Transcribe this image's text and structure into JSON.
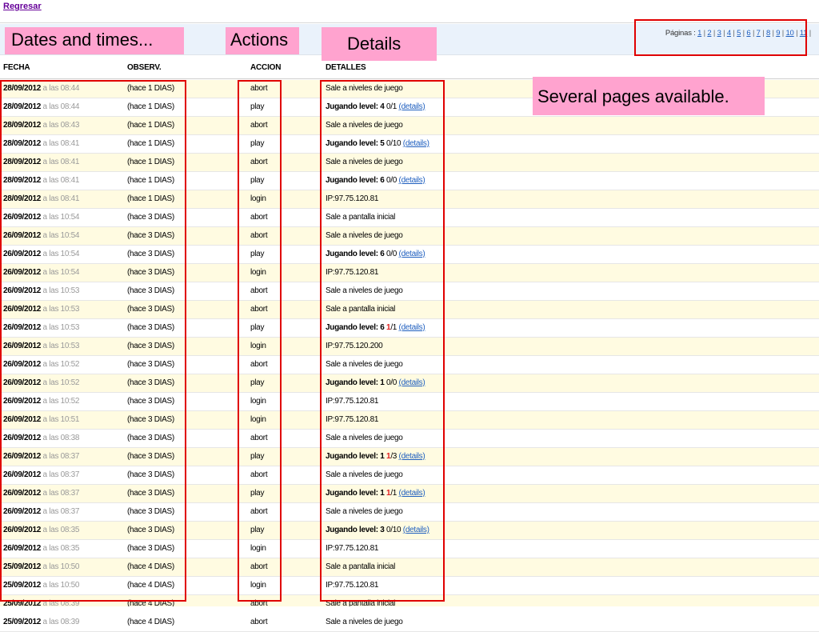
{
  "back_link": "Regresar",
  "pager": {
    "label": "Páginas :",
    "pages": [
      "1",
      "2",
      "3",
      "4",
      "5",
      "6",
      "7",
      "8",
      "9",
      "10",
      "11"
    ]
  },
  "columns": {
    "date": "FECHA",
    "observ": "OBSERV.",
    "action": "ACCION",
    "details": "DETALLES"
  },
  "at_text": "a las",
  "details_link": "(details)",
  "callouts": {
    "dates": "Dates and times...",
    "actions": "Actions",
    "details": "Details",
    "pages": "Several pages available."
  },
  "colors": {
    "highlight": "#e00000",
    "callout_bg": "#ffa3cf",
    "row_alt_bg": "#fffbe1",
    "link": "#1f5fbf"
  },
  "rows": [
    {
      "date": "28/09/2012",
      "time": "08:44",
      "obs": "(hace 1 DIAS)",
      "action": "abort",
      "detail": "Sale a niveles de juego"
    },
    {
      "date": "28/09/2012",
      "time": "08:44",
      "obs": "(hace 1 DIAS)",
      "action": "play",
      "level": "Jugando level: 4",
      "ratio": "0/1",
      "link": true
    },
    {
      "date": "28/09/2012",
      "time": "08:43",
      "obs": "(hace 1 DIAS)",
      "action": "abort",
      "detail": "Sale a niveles de juego"
    },
    {
      "date": "28/09/2012",
      "time": "08:41",
      "obs": "(hace 1 DIAS)",
      "action": "play",
      "level": "Jugando level: 5",
      "ratio": "0/10",
      "link": true
    },
    {
      "date": "28/09/2012",
      "time": "08:41",
      "obs": "(hace 1 DIAS)",
      "action": "abort",
      "detail": "Sale a niveles de juego"
    },
    {
      "date": "28/09/2012",
      "time": "08:41",
      "obs": "(hace 1 DIAS)",
      "action": "play",
      "level": "Jugando level: 6",
      "ratio": "0/0",
      "link": true
    },
    {
      "date": "28/09/2012",
      "time": "08:41",
      "obs": "(hace 1 DIAS)",
      "action": "login",
      "detail": "IP:97.75.120.81"
    },
    {
      "date": "26/09/2012",
      "time": "10:54",
      "obs": "(hace 3 DIAS)",
      "action": "abort",
      "detail": "Sale a pantalla inicial"
    },
    {
      "date": "26/09/2012",
      "time": "10:54",
      "obs": "(hace 3 DIAS)",
      "action": "abort",
      "detail": "Sale a niveles de juego"
    },
    {
      "date": "26/09/2012",
      "time": "10:54",
      "obs": "(hace 3 DIAS)",
      "action": "play",
      "level": "Jugando level: 6",
      "ratio": "0/0",
      "link": true
    },
    {
      "date": "26/09/2012",
      "time": "10:54",
      "obs": "(hace 3 DIAS)",
      "action": "login",
      "detail": "IP:97.75.120.81"
    },
    {
      "date": "26/09/2012",
      "time": "10:53",
      "obs": "(hace 3 DIAS)",
      "action": "abort",
      "detail": "Sale a niveles de juego"
    },
    {
      "date": "26/09/2012",
      "time": "10:53",
      "obs": "(hace 3 DIAS)",
      "action": "abort",
      "detail": "Sale a pantalla inicial"
    },
    {
      "date": "26/09/2012",
      "time": "10:53",
      "obs": "(hace 3 DIAS)",
      "action": "play",
      "level": "Jugando level: 6",
      "ratio": "1/1",
      "red": true,
      "link": true
    },
    {
      "date": "26/09/2012",
      "time": "10:53",
      "obs": "(hace 3 DIAS)",
      "action": "login",
      "detail": "IP:97.75.120.200"
    },
    {
      "date": "26/09/2012",
      "time": "10:52",
      "obs": "(hace 3 DIAS)",
      "action": "abort",
      "detail": "Sale a niveles de juego"
    },
    {
      "date": "26/09/2012",
      "time": "10:52",
      "obs": "(hace 3 DIAS)",
      "action": "play",
      "level": "Jugando level: 1",
      "ratio": "0/0",
      "link": true
    },
    {
      "date": "26/09/2012",
      "time": "10:52",
      "obs": "(hace 3 DIAS)",
      "action": "login",
      "detail": "IP:97.75.120.81"
    },
    {
      "date": "26/09/2012",
      "time": "10:51",
      "obs": "(hace 3 DIAS)",
      "action": "login",
      "detail": "IP:97.75.120.81"
    },
    {
      "date": "26/09/2012",
      "time": "08:38",
      "obs": "(hace 3 DIAS)",
      "action": "abort",
      "detail": "Sale a niveles de juego"
    },
    {
      "date": "26/09/2012",
      "time": "08:37",
      "obs": "(hace 3 DIAS)",
      "action": "play",
      "level": "Jugando level: 1",
      "ratio": "1/3",
      "red": true,
      "link": true
    },
    {
      "date": "26/09/2012",
      "time": "08:37",
      "obs": "(hace 3 DIAS)",
      "action": "abort",
      "detail": "Sale a niveles de juego"
    },
    {
      "date": "26/09/2012",
      "time": "08:37",
      "obs": "(hace 3 DIAS)",
      "action": "play",
      "level": "Jugando level: 1",
      "ratio": "1/1",
      "red": true,
      "link": true
    },
    {
      "date": "26/09/2012",
      "time": "08:37",
      "obs": "(hace 3 DIAS)",
      "action": "abort",
      "detail": "Sale a niveles de juego"
    },
    {
      "date": "26/09/2012",
      "time": "08:35",
      "obs": "(hace 3 DIAS)",
      "action": "play",
      "level": "Jugando level: 3",
      "ratio": "0/10",
      "link": true
    },
    {
      "date": "26/09/2012",
      "time": "08:35",
      "obs": "(hace 3 DIAS)",
      "action": "login",
      "detail": "IP:97.75.120.81"
    },
    {
      "date": "25/09/2012",
      "time": "10:50",
      "obs": "(hace 4 DIAS)",
      "action": "abort",
      "detail": "Sale a pantalla inicial"
    },
    {
      "date": "25/09/2012",
      "time": "10:50",
      "obs": "(hace 4 DIAS)",
      "action": "login",
      "detail": "IP:97.75.120.81"
    },
    {
      "date": "25/09/2012",
      "time": "08:39",
      "obs": "(hace 4 DIAS)",
      "action": "abort",
      "detail": "Sale a pantalla inicial"
    },
    {
      "date": "25/09/2012",
      "time": "08:39",
      "obs": "(hace 4 DIAS)",
      "action": "abort",
      "detail": "Sale a niveles de juego"
    }
  ]
}
